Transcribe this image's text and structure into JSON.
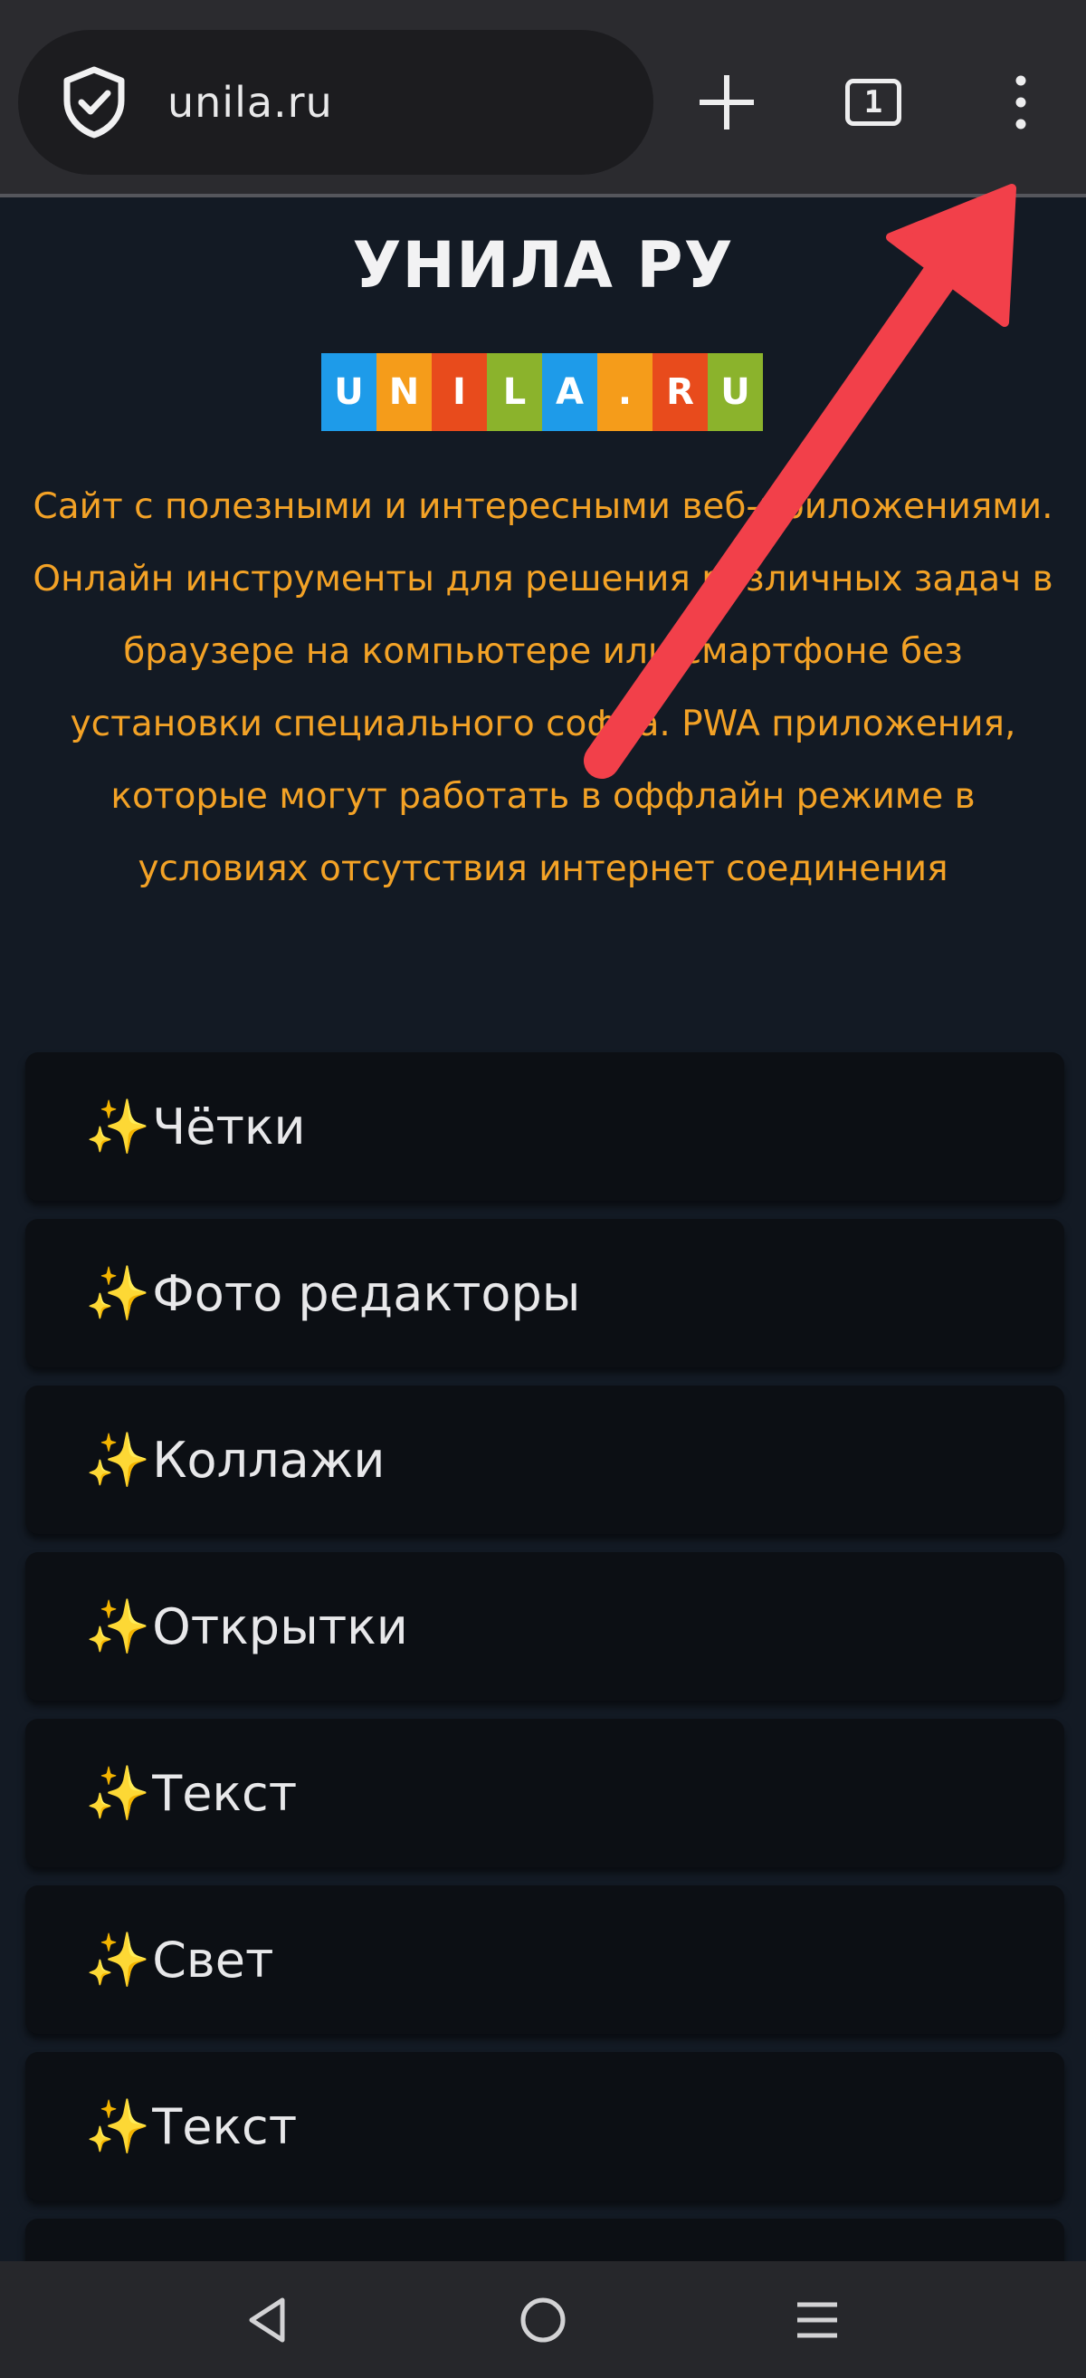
{
  "browser": {
    "url": "unila.ru",
    "tab_count": "1",
    "icons": {
      "security": "shield-check-icon",
      "new_tab": "plus-icon",
      "tabs": "tab-counter-icon",
      "menu": "more-vertical-icon"
    }
  },
  "page": {
    "title": "УНИЛА РУ",
    "logo": {
      "letters": [
        "U",
        "N",
        "I",
        "L",
        "A",
        ".",
        "R",
        "U"
      ],
      "colors": [
        "#1e9be9",
        "#f59c1a",
        "#e84b1c",
        "#8bb32c",
        "#1e9be9",
        "#f59c1a",
        "#e84b1c",
        "#8bb32c"
      ]
    },
    "description": "Сайт с полезными и интересными веб-приложениями. Онлайн инструменты для решения различных задач в браузере на компьютере или смартфоне без установки специального софта. PWA приложения, которые могут работать в оффлайн режиме в условиях отсутствия интернет соединения",
    "items": [
      {
        "icon": "✨",
        "label": "Чётки"
      },
      {
        "icon": "✨",
        "label": "Фото редакторы"
      },
      {
        "icon": "✨",
        "label": "Коллажи"
      },
      {
        "icon": "✨",
        "label": "Открытки"
      },
      {
        "icon": "✨",
        "label": "Текст"
      },
      {
        "icon": "✨",
        "label": "Свет"
      },
      {
        "icon": "✨",
        "label": "Текст"
      },
      {
        "icon": "",
        "label": ""
      }
    ]
  },
  "navbar": {
    "icons": [
      "back-triangle-icon",
      "home-circle-icon",
      "recents-menu-icon"
    ]
  },
  "colors": {
    "toolbar_bg": "#2b2b2f",
    "page_bg": "#131a24",
    "card_bg": "#0c0f14",
    "description_text": "#f3a226",
    "annotation_arrow": "#f2404a"
  }
}
